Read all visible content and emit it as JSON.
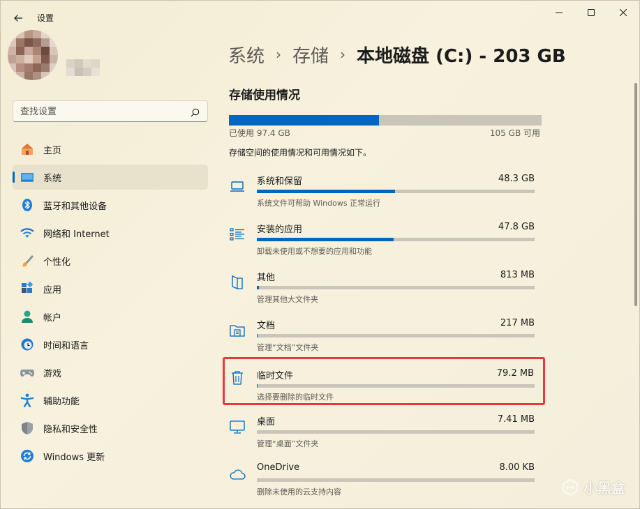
{
  "window": {
    "title": "设置"
  },
  "search": {
    "placeholder": "查找设置"
  },
  "sidebar": {
    "items": [
      {
        "label": "主页",
        "icon": "home-icon"
      },
      {
        "label": "系统",
        "icon": "system-icon",
        "active": true
      },
      {
        "label": "蓝牙和其他设备",
        "icon": "bluetooth-icon"
      },
      {
        "label": "网络和 Internet",
        "icon": "wifi-icon"
      },
      {
        "label": "个性化",
        "icon": "brush-icon"
      },
      {
        "label": "应用",
        "icon": "apps-icon"
      },
      {
        "label": "帐户",
        "icon": "account-icon"
      },
      {
        "label": "时间和语言",
        "icon": "clock-globe-icon"
      },
      {
        "label": "游戏",
        "icon": "gamepad-icon"
      },
      {
        "label": "辅助功能",
        "icon": "accessibility-icon"
      },
      {
        "label": "隐私和安全性",
        "icon": "shield-icon"
      },
      {
        "label": "Windows 更新",
        "icon": "update-icon"
      }
    ]
  },
  "breadcrumb": {
    "items": [
      "系统",
      "存储"
    ],
    "current": "本地磁盘 (C:) - 203 GB"
  },
  "storage": {
    "section_title": "存储使用情况",
    "used_label": "已使用 97.4 GB",
    "free_label": "105 GB 可用",
    "used_fraction": 0.48,
    "description": "存储空间的使用情况和可用情况如下。",
    "categories": [
      {
        "name": "系统和保留",
        "size": "48.3 GB",
        "subtitle": "系统文件可帮助 Windows 正常运行",
        "fraction": 0.497,
        "icon": "laptop-icon"
      },
      {
        "name": "安装的应用",
        "size": "47.8 GB",
        "subtitle": "卸载未使用或不想要的应用和功能",
        "fraction": 0.492,
        "icon": "app-list-icon"
      },
      {
        "name": "其他",
        "size": "813 MB",
        "subtitle": "管理其他大文件夹",
        "fraction": 0.008,
        "icon": "folder-page-icon"
      },
      {
        "name": "文档",
        "size": "217 MB",
        "subtitle": "管理“文档”文件夹",
        "fraction": 0.003,
        "icon": "documents-folder-icon"
      },
      {
        "name": "临时文件",
        "size": "79.2 MB",
        "subtitle": "选择要删除的临时文件",
        "fraction": 0.001,
        "icon": "trash-icon",
        "highlighted": true
      },
      {
        "name": "桌面",
        "size": "7.41 MB",
        "subtitle": "管理“桌面”文件夹",
        "fraction": 0.0,
        "icon": "monitor-icon"
      },
      {
        "name": "OneDrive",
        "size": "8.00 KB",
        "subtitle": "删除未使用的云支持内容",
        "fraction": 0.0,
        "icon": "cloud-icon"
      }
    ]
  },
  "watermark": {
    "text": "小黑盒"
  },
  "colors": {
    "accent": "#0067c0",
    "highlight_border": "#e8383a"
  }
}
